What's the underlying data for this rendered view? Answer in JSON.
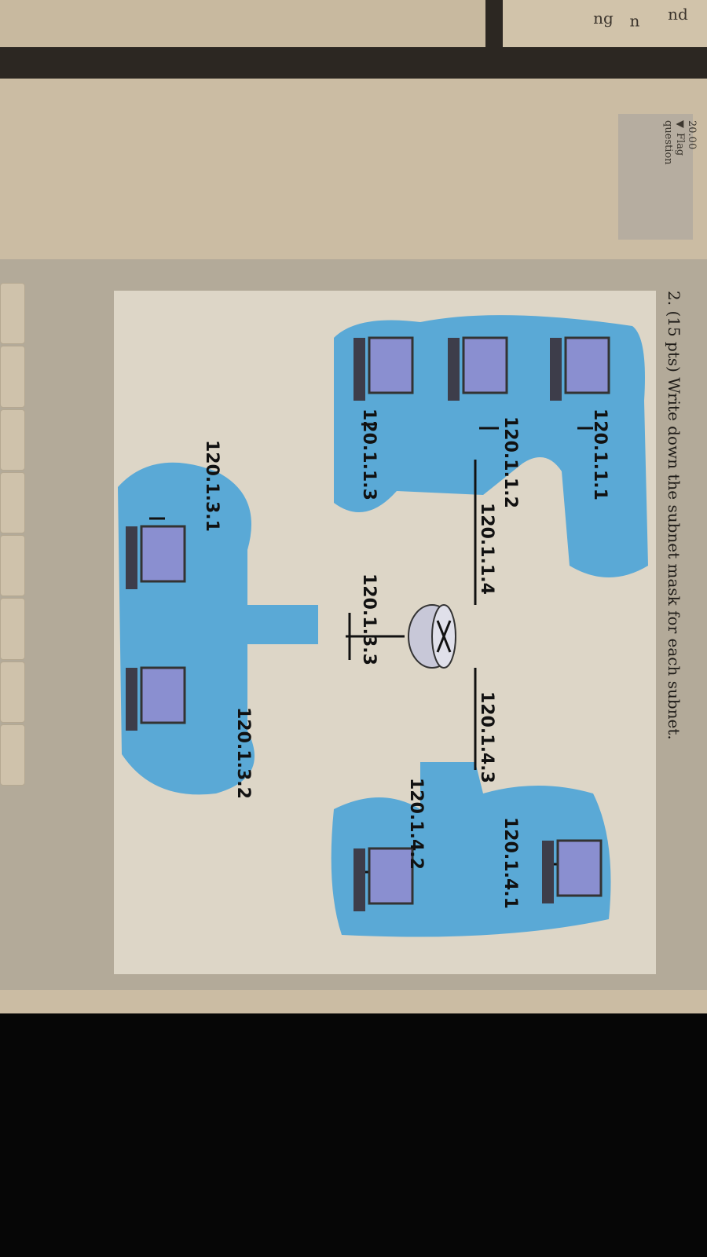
{
  "sidebar_fragments": [
    "nd",
    "n",
    "ng"
  ],
  "question_info": {
    "score": "20.00",
    "flag_label": "Flag",
    "flag_label2": "question"
  },
  "question": {
    "text": "2. (15 pts) Write down the subnet mask for each subnet."
  },
  "diagram": {
    "router_icon": "router-icon",
    "labels": {
      "h111": "120.1.1.1",
      "h112": "120.1.1.2",
      "h113": "120.1.1.3",
      "r114": "120.1.1.4",
      "r133": "120.1.3.3",
      "r143": "120.1.4.3",
      "h141": "120.1.4.1",
      "h142": "120.1.4.2",
      "h131": "120.1.3.1",
      "h132": "120.1.3.2"
    },
    "subnet_color": "#5aa9d6"
  }
}
